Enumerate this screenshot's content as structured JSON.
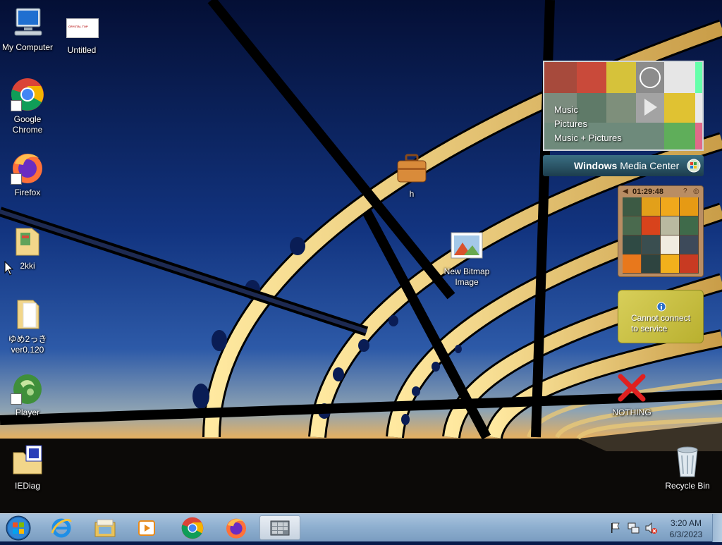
{
  "desktop": {
    "icons": [
      {
        "label": "My Computer",
        "icon": "computer-icon"
      },
      {
        "label": "Untitled",
        "icon": "image-document-icon",
        "thumb_text": "CRYSTAL TOP"
      },
      {
        "label": "Google\nChrome",
        "icon": "chrome-icon"
      },
      {
        "label": "Firefox",
        "icon": "firefox-icon"
      },
      {
        "label": "2kki",
        "icon": "folder-icon"
      },
      {
        "label": "ゆめ2っき\nver0.120",
        "icon": "folder-icon"
      },
      {
        "label": "Player",
        "icon": "player-icon"
      },
      {
        "label": "IEDiag",
        "icon": "iediag-folder-icon"
      },
      {
        "label": "h",
        "icon": "briefcase-icon"
      },
      {
        "label": "New Bitmap\nImage",
        "icon": "bitmap-icon"
      },
      {
        "label": "NOTHING",
        "icon": "red-x-icon"
      },
      {
        "label": "Recycle Bin",
        "icon": "recycle-bin-icon"
      }
    ]
  },
  "gadgets": {
    "media_center": {
      "menu": [
        "Music",
        "Pictures",
        "Music + Pictures"
      ],
      "title_bold": "Windows",
      "title_rest": " Media Center"
    },
    "clock_puzzle": {
      "time": "01:29:48"
    },
    "weather": {
      "message": "Cannot connect\nto service"
    }
  },
  "taskbar": {
    "buttons": [
      "start-orb",
      "internet-explorer-icon",
      "windows-explorer-icon",
      "media-player-icon",
      "chrome-icon",
      "firefox-icon",
      "puzzle-app-icon"
    ],
    "tray": {
      "time": "3:20 AM",
      "date": "6/3/2023",
      "icons": [
        "action-center-flag-icon",
        "network-icon",
        "volume-muted-icon"
      ]
    }
  },
  "colors": {
    "sky_top": "#06133f",
    "sky_mid": "#143a8a",
    "horizon": "#f2b155",
    "bridge": "#f3dc86",
    "taskbar": "#8fb0d0"
  }
}
